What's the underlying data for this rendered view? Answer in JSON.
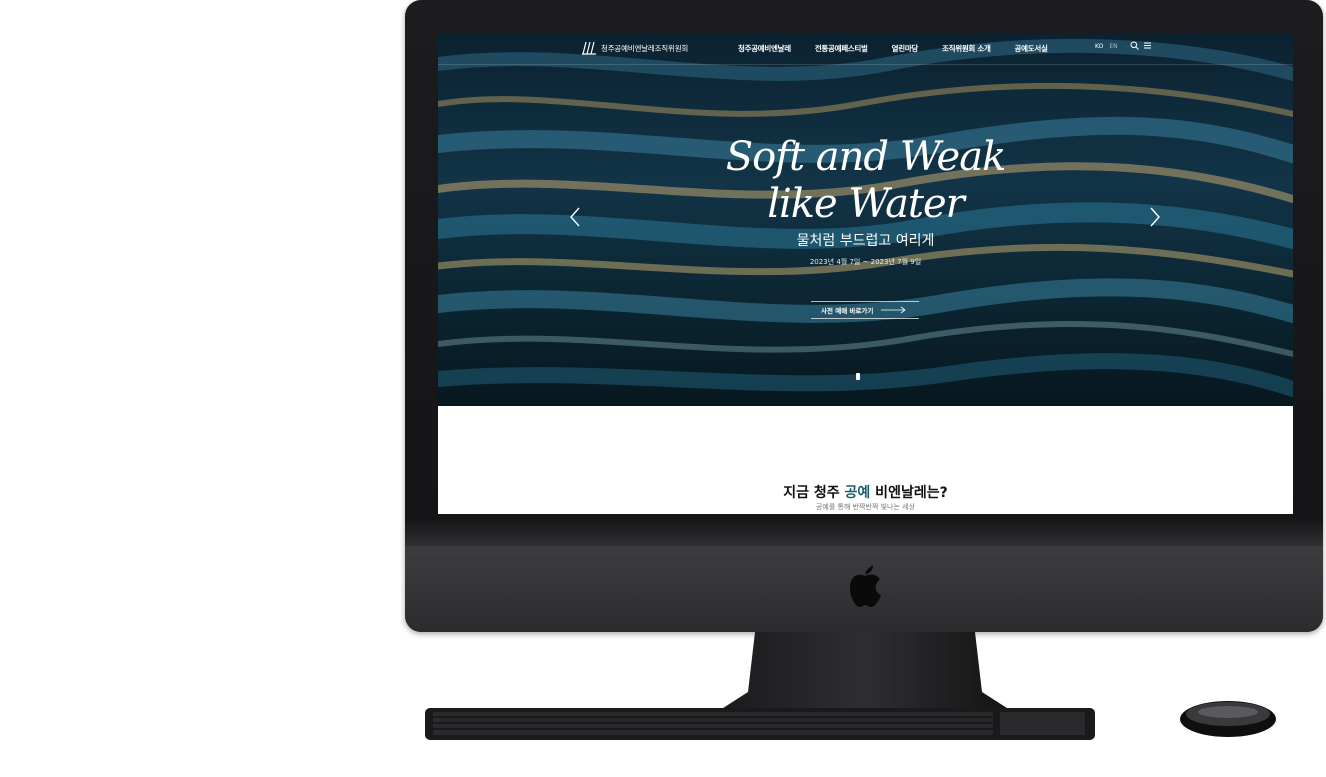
{
  "site": {
    "logo_text": "청주공예비엔날레조직위원회",
    "nav": [
      "청주공예비엔날레",
      "전통공예페스티벌",
      "열린마당",
      "조직위원회 소개",
      "공예도서실"
    ],
    "lang": [
      "KO",
      "EN"
    ]
  },
  "hero": {
    "headline_line1": "Soft and Weak",
    "headline_line2": "like Water",
    "subtitle": "물처럼 부드럽고 여리게",
    "dates": "2023년 4월 7일 ~ 2023년 7월 9일",
    "cta_label": "사전 예매 바로가기"
  },
  "intro": {
    "title_before": "지금 청주 ",
    "title_accent": "공예",
    "title_after": " 비엔날레는?",
    "subtitle": "공예를 통해 반짝반짝 빛나는 세상"
  },
  "colors": {
    "accent": "#1d5c6e",
    "hero_dark": "#0c2633",
    "device": "#1c1c1e"
  },
  "icons": [
    "search-icon",
    "menu-icon",
    "chevron-left-icon",
    "chevron-right-icon",
    "arrow-right-icon",
    "apple-logo-icon"
  ]
}
